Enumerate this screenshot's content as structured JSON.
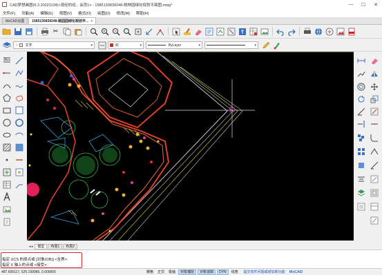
{
  "titlebar": {
    "title": "CAD梦想画图(6.3.20221104)<现经的经，会员1> - 1585130839248-桃林园绿化规划平面图.mwg*",
    "minimize": "—",
    "maximize": "☐",
    "close": "✕"
  },
  "menu": {
    "items": [
      "文件(F)",
      "功能(A)",
      "编辑(E)",
      "视图(V)",
      "格式(O)",
      "绘图(D)",
      "修改(M)",
      "帮助(H)"
    ]
  },
  "doc_tabs": [
    {
      "label": "MxCAD云图"
    },
    {
      "label": "1585130839248-桃园园绿化规划平..."
    }
  ],
  "doc_tab_close": "×",
  "toolbar": {
    "layer_combo": "文字",
    "color_combo": "红",
    "linetype_combo": "ByLayer",
    "color_swatch": "#e02020",
    "combo_arrow": "▾"
  },
  "toolbar_icons": [
    "open-file-icon",
    "save-icon",
    "save-as-icon",
    "print-icon",
    "cut-icon",
    "copy-icon",
    "paste-icon",
    "zoom-window-icon",
    "zoom-in-icon",
    "zoom-out-icon",
    "zoom-extents-icon",
    "pan-icon",
    "orbit-icon",
    "measure-icon",
    "select-icon",
    "match-properties-icon",
    "erase-icon",
    "properties-icon",
    "layer-icon",
    "block-icon",
    "text-icon",
    "table-icon",
    "image-icon",
    "undo-icon",
    "redo-icon",
    "plot-icon",
    "cloud-icon",
    "share-icon",
    "picture-icon",
    "pdf-icon"
  ],
  "layout_tabs": {
    "nav": "◂ ▸",
    "tabs": [
      "模型",
      "布局1",
      "布局2"
    ]
  },
  "command": {
    "line1": "指定 UCS 的原点或 [对象(OB)] <全界>:",
    "line2": "指定 X 轴上的点或 <接受>:"
  },
  "status": {
    "coords": "487.699117,  525.199086,  0.000000",
    "buttons": [
      "栅格",
      "正交",
      "极轴",
      "对象捕捉",
      "对象追踪",
      "DYN",
      "线宽"
    ],
    "active": [
      false,
      false,
      false,
      true,
      true,
      true,
      false
    ],
    "link": "提交软件问题或增加新功能",
    "brand": "MxCAD"
  }
}
